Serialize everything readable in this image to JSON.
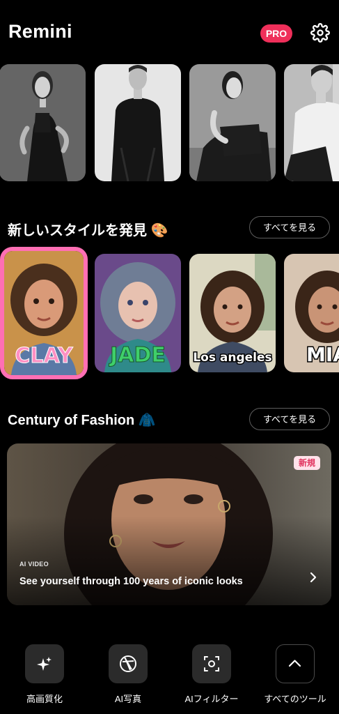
{
  "header": {
    "app_title": "Remini",
    "pro_label": "PRO",
    "settings_icon": "gear-icon",
    "brand_color": "#ef2f5a"
  },
  "hero_gallery": {
    "items": [
      {
        "label": "black dress portrait"
      },
      {
        "label": "black t-shirt portrait"
      },
      {
        "label": "off-shoulder portrait"
      },
      {
        "label": "white tank top portrait"
      }
    ]
  },
  "styles_section": {
    "title": "新しいスタイルを発見 🎨",
    "see_all": "すべてを見る",
    "cards": [
      {
        "caption": "CLAY",
        "selected": true
      },
      {
        "caption": "JADE",
        "selected": false
      },
      {
        "caption": "Los angeles",
        "selected": false
      },
      {
        "caption": "MIA",
        "selected": false
      }
    ],
    "selected_border_color": "#ff6fb4"
  },
  "fashion_section": {
    "title": "Century of Fashion 🧥",
    "see_all": "すべてを見る",
    "feature": {
      "badge": "新規",
      "kicker": "AI VIDEO",
      "title": "See yourself through 100 years of iconic looks",
      "chevron_icon": "chevron-right-icon"
    }
  },
  "bottom_tools": [
    {
      "label": "高画質化",
      "icon": "sparkle-icon"
    },
    {
      "label": "AI写真",
      "icon": "aperture-icon"
    },
    {
      "label": "AIフィルター",
      "icon": "face-scan-icon"
    },
    {
      "label": "すべてのツール",
      "icon": "chevron-up-icon"
    }
  ]
}
